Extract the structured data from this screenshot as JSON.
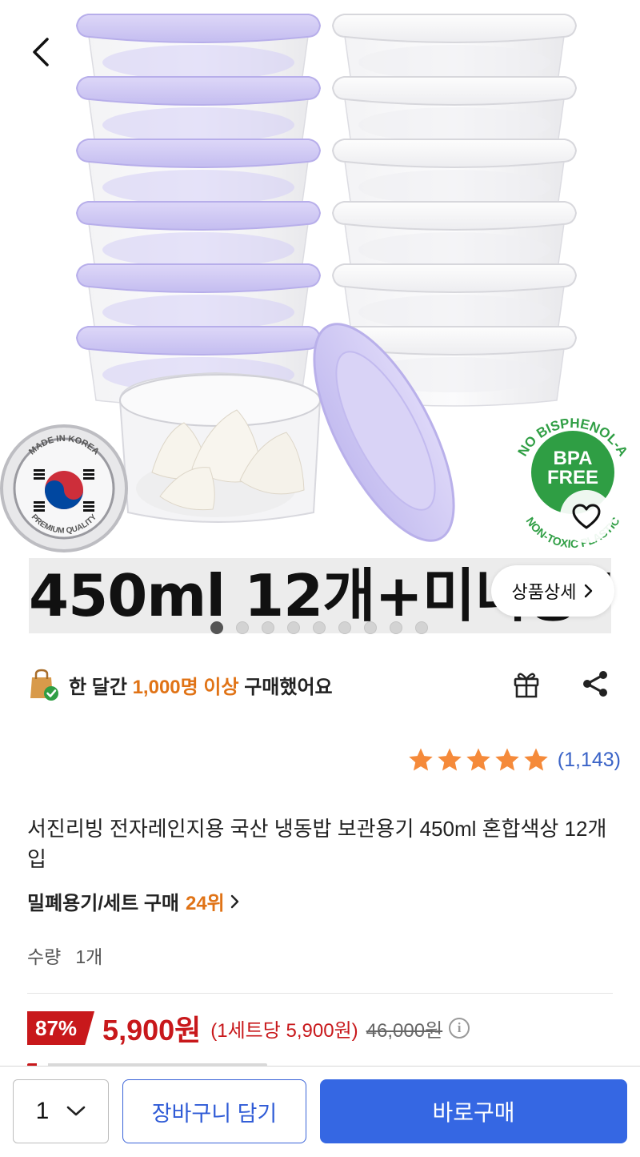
{
  "hero": {
    "banner_text": "450ml 12개+미니용기",
    "detail_button_label": "상품상세",
    "badge_left_top": "MADE IN KOREA",
    "badge_left_bottom": "PREMIUM QUALITY",
    "badge_right_top": "NO BISPHENOL-A",
    "badge_right_center_1": "BPA",
    "badge_right_center_2": "FREE",
    "badge_right_bottom": "NON-TOXIC PLASTIC",
    "slide_total": 9,
    "slide_active": 1
  },
  "purchase_info": {
    "prefix": "한 달간 ",
    "highlight": "1,000명 이상",
    "suffix": " 구매했어요"
  },
  "rating": {
    "stars": 5,
    "count": "(1,143)"
  },
  "product": {
    "title": "서진리빙 전자레인지용 국산 냉동밥 보관용기 450ml 혼합색상 12개입",
    "category": "밀폐용기/세트 구매",
    "rank": "24위"
  },
  "quantity": {
    "label": "수량",
    "value": "1개"
  },
  "price": {
    "discount": "87%",
    "sale": "5,900원",
    "per_unit": "(1세트당 5,900원)",
    "original": "46,000원"
  },
  "bottom_bar": {
    "qty_value": "1",
    "cart_label": "장바구니 담기",
    "buy_label": "바로구매"
  },
  "colors": {
    "accent_blue": "#3567e3",
    "price_red": "#c8181b",
    "highlight_orange": "#e07316",
    "star_orange": "#f58a3a",
    "bpa_green": "#2f9e44",
    "lid_purple": "#cfc9f3"
  }
}
